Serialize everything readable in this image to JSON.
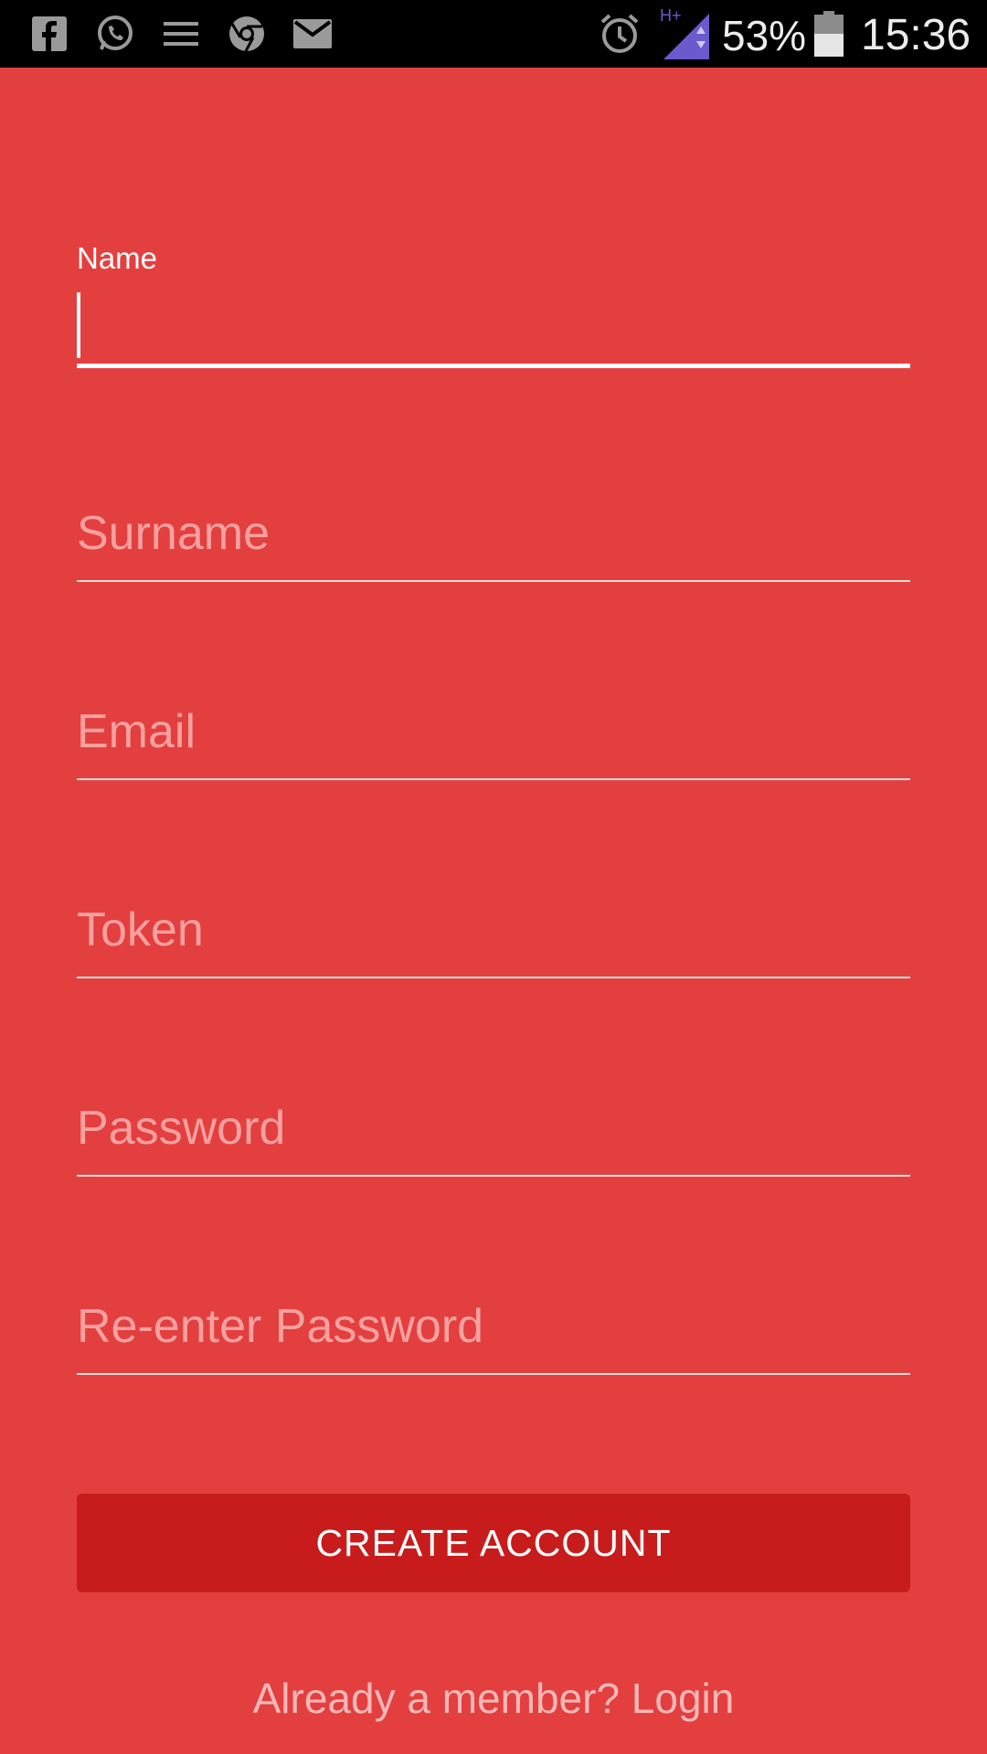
{
  "status_bar": {
    "battery_percent": "53%",
    "time": "15:36",
    "network_type": "H+",
    "icons": [
      "facebook-icon",
      "whatsapp-icon",
      "menu-lines-icon",
      "chrome-icon",
      "gmail-icon",
      "alarm-icon",
      "signal-icon",
      "battery-icon"
    ]
  },
  "form": {
    "name": {
      "label": "Name",
      "value": ""
    },
    "surname": {
      "placeholder": "Surname",
      "value": ""
    },
    "email": {
      "placeholder": "Email",
      "value": ""
    },
    "token": {
      "placeholder": "Token",
      "value": ""
    },
    "password": {
      "placeholder": "Password",
      "value": ""
    },
    "reenter_password": {
      "placeholder": "Re-enter Password",
      "value": ""
    }
  },
  "actions": {
    "create_account_label": "CREATE ACCOUNT",
    "login_link_label": "Already a member? Login"
  },
  "colors": {
    "background": "#e33f3f",
    "button": "#c81b1b",
    "status_bar": "#000000",
    "placeholder": "#f7a0a0",
    "network_accent": "#6a5acd"
  }
}
